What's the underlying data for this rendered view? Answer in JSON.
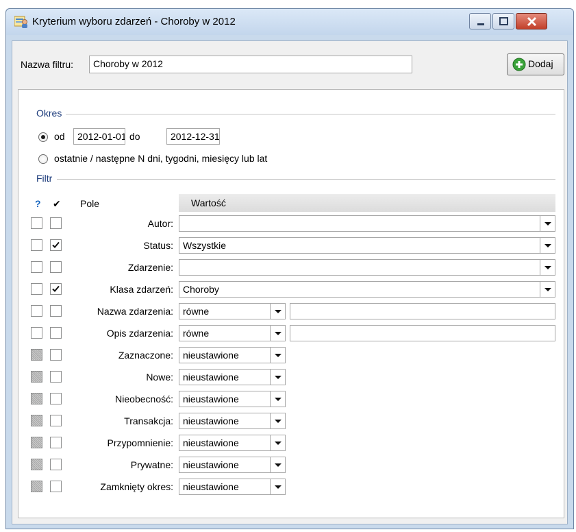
{
  "window": {
    "title": "Kryterium wyboru zdarzeń - Choroby w 2012"
  },
  "filter_name": {
    "label": "Nazwa filtru:",
    "value": "Choroby w 2012"
  },
  "add_button": {
    "label": "Dodaj",
    "icon": "plus-circle-icon",
    "color": "#2e9e2e"
  },
  "period": {
    "section_title": "Okres",
    "option_range": {
      "label_from": "od",
      "from": "2012-01-01",
      "label_to": "do",
      "to": "2012-12-31",
      "selected": true
    },
    "option_last_n": {
      "label": "ostatnie / następne N dni, tygodni, miesięcy lub lat",
      "selected": false
    }
  },
  "filter": {
    "section_title": "Filtr",
    "columns": {
      "question": "?",
      "check": "✔",
      "field": "Pole",
      "value": "Wartość"
    },
    "rows": [
      {
        "label": "Autor:",
        "type": "combo",
        "value": "",
        "q_grey": false,
        "checked": false
      },
      {
        "label": "Status:",
        "type": "combo",
        "value": "Wszystkie",
        "q_grey": false,
        "checked": true
      },
      {
        "label": "Zdarzenie:",
        "type": "combo",
        "value": "",
        "q_grey": false,
        "checked": false
      },
      {
        "label": "Klasa zdarzeń:",
        "type": "combo",
        "value": "Choroby",
        "q_grey": false,
        "checked": true
      },
      {
        "label": "Nazwa zdarzenia:",
        "type": "text",
        "value": "równe",
        "text": "",
        "q_grey": false,
        "checked": false
      },
      {
        "label": "Opis zdarzenia:",
        "type": "text",
        "value": "równe",
        "text": "",
        "q_grey": false,
        "checked": false
      },
      {
        "label": "Zaznaczone:",
        "type": "small",
        "value": "nieustawione",
        "q_grey": true,
        "checked": false
      },
      {
        "label": "Nowe:",
        "type": "small",
        "value": "nieustawione",
        "q_grey": true,
        "checked": false
      },
      {
        "label": "Nieobecność:",
        "type": "small",
        "value": "nieustawione",
        "q_grey": true,
        "checked": false
      },
      {
        "label": "Transakcja:",
        "type": "small",
        "value": "nieustawione",
        "q_grey": true,
        "checked": false
      },
      {
        "label": "Przypomnienie:",
        "type": "small",
        "value": "nieustawione",
        "q_grey": true,
        "checked": false
      },
      {
        "label": "Prywatne:",
        "type": "small",
        "value": "nieustawione",
        "q_grey": true,
        "checked": false
      },
      {
        "label": "Zamknięty okres:",
        "type": "small",
        "value": "nieustawione",
        "q_grey": true,
        "checked": false
      }
    ]
  },
  "colors": {
    "section_title": "#1c3b7b",
    "question_mark": "#1565c0"
  }
}
